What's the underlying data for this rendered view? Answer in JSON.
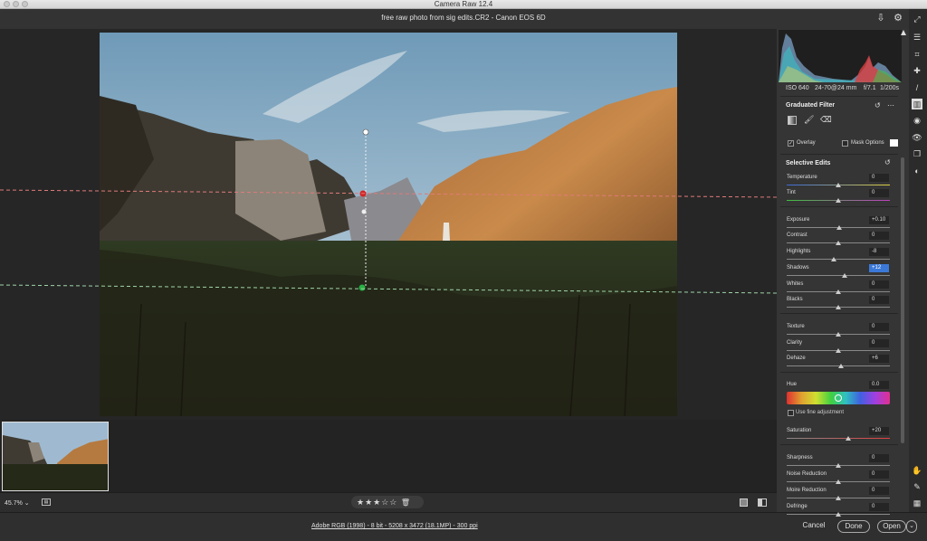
{
  "window": {
    "app_title": "Camera Raw 12.4",
    "file_title": "free raw photo from sig edits.CR2  -  Canon EOS 6D"
  },
  "camera_info": {
    "iso": "ISO 640",
    "lens": "24-70@24 mm",
    "aperture": "f/7.1",
    "shutter": "1/200s"
  },
  "filter": {
    "title": "Graduated Filter",
    "overlay_label": "Overlay",
    "overlay_checked": true,
    "mask_options_label": "Mask Options"
  },
  "selective_edits": {
    "title": "Selective Edits",
    "rows": [
      {
        "label": "Temperature",
        "value": "0",
        "level": 0.5
      },
      {
        "label": "Tint",
        "value": "0",
        "level": 0.5
      },
      {
        "label": "Exposure",
        "value": "+0.10",
        "level": 0.51
      },
      {
        "label": "Contrast",
        "value": "0",
        "level": 0.5
      },
      {
        "label": "Highlights",
        "value": "-8",
        "level": 0.46
      },
      {
        "label": "Shadows",
        "value": "+12",
        "level": 0.56,
        "highlighted": true
      },
      {
        "label": "Whites",
        "value": "0",
        "level": 0.5
      },
      {
        "label": "Blacks",
        "value": "0",
        "level": 0.5
      },
      {
        "label": "Texture",
        "value": "0",
        "level": 0.5
      },
      {
        "label": "Clarity",
        "value": "0",
        "level": 0.5
      },
      {
        "label": "Dehaze",
        "value": "+6",
        "level": 0.53
      },
      {
        "label": "Hue",
        "value": "0.0",
        "level": 0.5
      },
      {
        "label": "Saturation",
        "value": "+20",
        "level": 0.6
      },
      {
        "label": "Sharpness",
        "value": "0",
        "level": 0.5
      },
      {
        "label": "Noise Reduction",
        "value": "0",
        "level": 0.5
      },
      {
        "label": "Moire Reduction",
        "value": "0",
        "level": 0.5
      },
      {
        "label": "Defringe",
        "value": "0",
        "level": 0.5
      }
    ],
    "fine_adjust_label": "Use fine adjustment"
  },
  "status": {
    "zoom": "45.7%",
    "rating": "★★★☆☆",
    "workflow_link": "Adobe RGB (1998) - 8 bit - 5208 x 3472 (18.1MP) - 300 ppi"
  },
  "footer": {
    "cancel": "Cancel",
    "done": "Done",
    "open": "Open"
  },
  "colors": {
    "accent": "#3b79d8",
    "panel_bg": "#353535",
    "canvas_bg": "#262626"
  }
}
